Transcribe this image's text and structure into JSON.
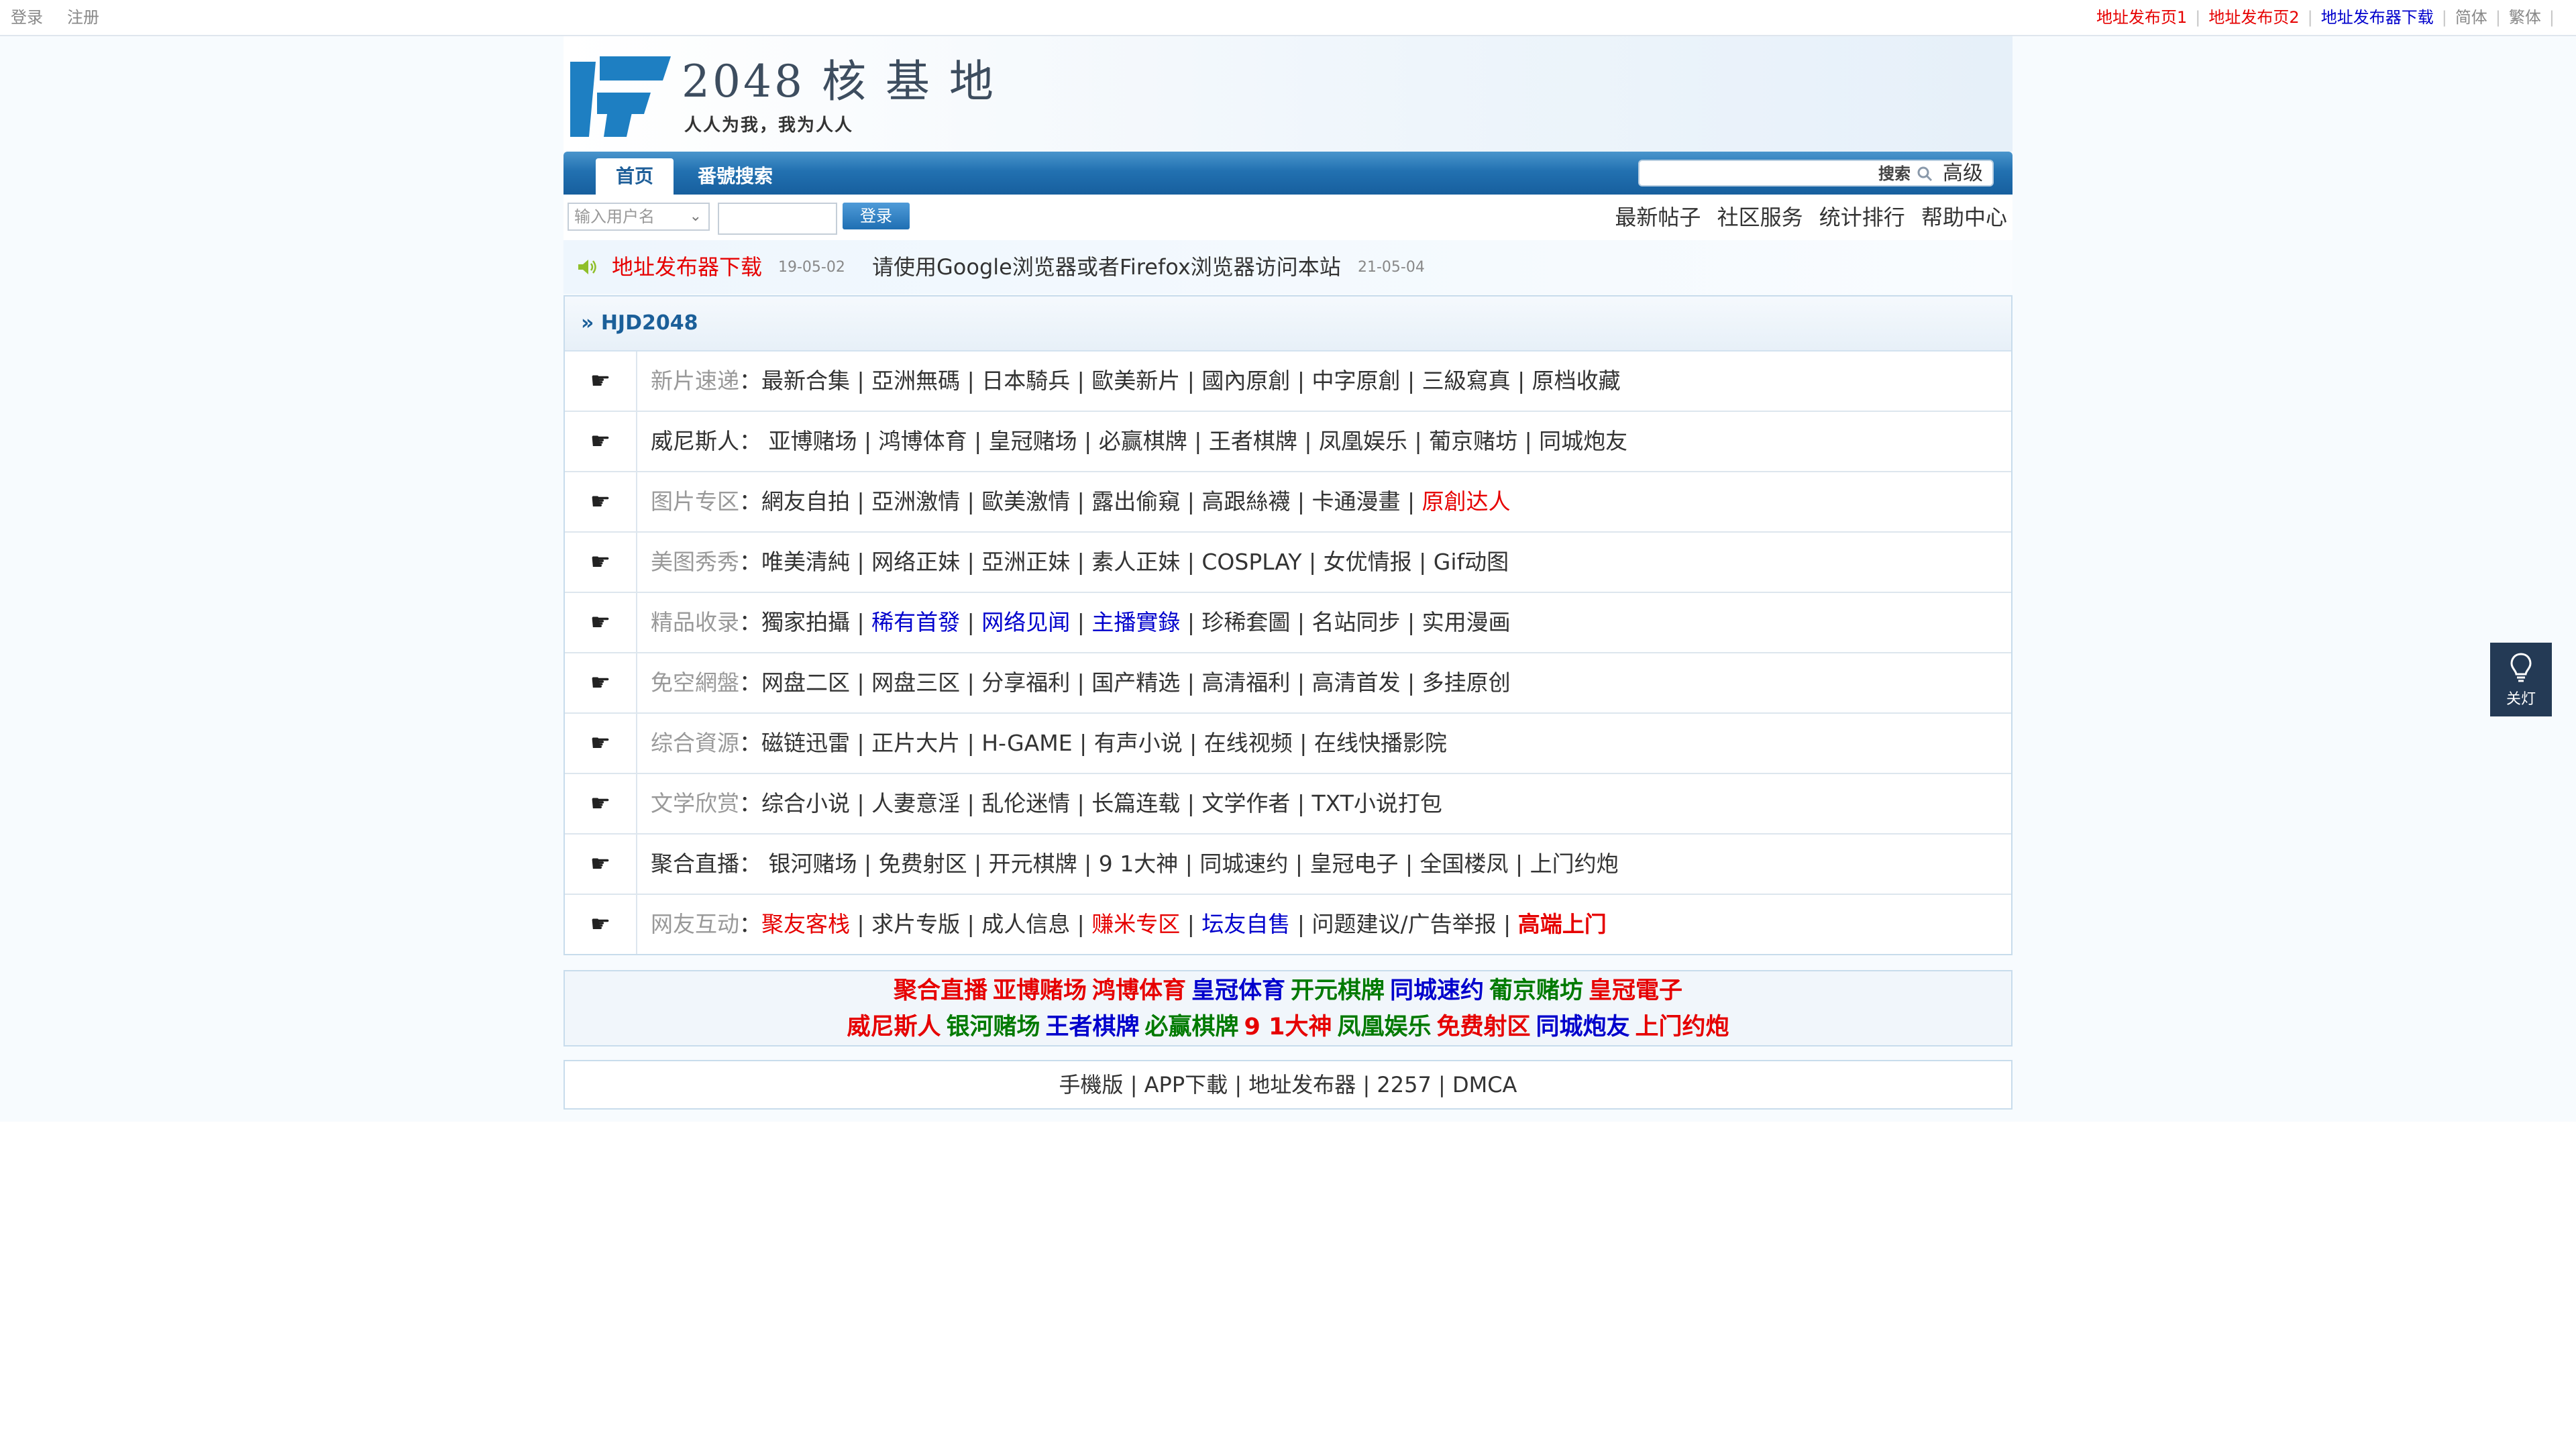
{
  "topbar": {
    "login": "登录",
    "register": "注册",
    "links": [
      "地址发布页1",
      "地址发布页2",
      "地址发布器下载",
      "简体",
      "繁体"
    ]
  },
  "header": {
    "logo_title": "2048 核 基 地",
    "logo_slogan": "人人为我，我为人人"
  },
  "nav": {
    "tabs": [
      "首页",
      "番號搜索"
    ],
    "search_label": "搜索",
    "advanced": "高级"
  },
  "login": {
    "username_placeholder": "输入用户名",
    "button": "登录"
  },
  "quicklinks": [
    "最新帖子",
    "社区服务",
    "统计排行",
    "帮助中心"
  ],
  "notice": {
    "item1": "地址发布器下载",
    "date1": "19-05-02",
    "item2": "请使用Google浏览器或者Firefox浏览器访问本站",
    "date2": "21-05-04"
  },
  "forum": {
    "title": "» HJD2048",
    "rows": [
      {
        "cat": "新片速递",
        "links": "：最新合集 | 亞洲無碼 | 日本騎兵 | 歐美新片 | 國內原創 | 中字原創 | 三級寫真 | 原档收藏"
      },
      {
        "cat": "威尼斯人：",
        "links": " 亚博赌场 | 鸿博体育 | 皇冠赌场 | 必赢棋牌 | 王者棋牌 | 凤凰娱乐 | 葡京赌坊 | 同城炮友"
      },
      {
        "cat": "图片专区",
        "links": "：網友自拍 | 亞洲激情 | 歐美激情 | 露出偷窺 | 高跟絲襪 | 卡通漫畫 | ",
        "extra": "原創达人"
      },
      {
        "cat": "美图秀秀",
        "links": "：唯美清純 | 网络正妹 | 亞洲正妹 | 素人正妹 | COSPLAY | 女优情报 | Gif动图"
      },
      {
        "cat": "精品收录",
        "links1": "：獨家拍攝 | ",
        "blue1": "稀有首發",
        "sep1": " | ",
        "blue2": "网络见闻",
        "sep2": " | ",
        "blue3": "主播實錄",
        "links2": " | 珍稀套圖 | 名站同步 | 实用漫画"
      },
      {
        "cat": "免空網盤",
        "links": "：网盘二区 | 网盘三区 | 分享福利 | 国产精选 | 高清福利 | 高清首发 | 多挂原创"
      },
      {
        "cat": "综合資源",
        "links": "：磁链迅雷 | 正片大片 | H-GAME | 有声小说 | 在线视频 | 在线快播影院"
      },
      {
        "cat": "文学欣赏",
        "links": "：综合小说 | 人妻意淫 | 乱伦迷情 | 长篇连载 | 文学作者 | TXT小说打包"
      },
      {
        "cat": "聚合直播：",
        "links": " 银河赌场 | 免费射区 | 开元棋牌 | 9 1大神 | 同城速约 | 皇冠电子 | 全国楼凤 | 上门约炮"
      },
      {
        "cat": "网友互动",
        "colon": "：",
        "red1": "聚友客栈",
        "t1": " | 求片专版 | 成人信息 | ",
        "red2": "赚米专区",
        "t2": " | ",
        "blue1": "坛友自售",
        "t3": " | 问题建议/广告举报 | ",
        "red3": "高端上门"
      }
    ]
  },
  "ads": {
    "line1": [
      {
        "text": "聚合直播",
        "color": "#e60000"
      },
      {
        "text": "亚博赌场",
        "color": "#e60000"
      },
      {
        "text": "鸿博体育",
        "color": "#e60000"
      },
      {
        "text": "皇冠体育",
        "color": "#0000cc"
      },
      {
        "text": "开元棋牌",
        "color": "#007a00"
      },
      {
        "text": "同城速约",
        "color": "#0000cc"
      },
      {
        "text": "葡京赌坊",
        "color": "#007a00"
      },
      {
        "text": "皇冠電子",
        "color": "#e60000"
      }
    ],
    "line2": [
      {
        "text": "威尼斯人",
        "color": "#e60000"
      },
      {
        "text": "银河赌场",
        "color": "#007a00"
      },
      {
        "text": "王者棋牌",
        "color": "#0000cc"
      },
      {
        "text": "必赢棋牌",
        "color": "#007a00"
      },
      {
        "text": "9 1大神",
        "color": "#e60000"
      },
      {
        "text": "凤凰娱乐",
        "color": "#007a00"
      },
      {
        "text": "免费射区",
        "color": "#e60000"
      },
      {
        "text": "同城炮友",
        "color": "#0000cc"
      },
      {
        "text": "上门约炮",
        "color": "#e60000"
      }
    ]
  },
  "footer": {
    "text": "手機版 | APP下載 | 地址发布器 | 2257 | DMCA"
  },
  "lamp": {
    "label": "关灯"
  }
}
